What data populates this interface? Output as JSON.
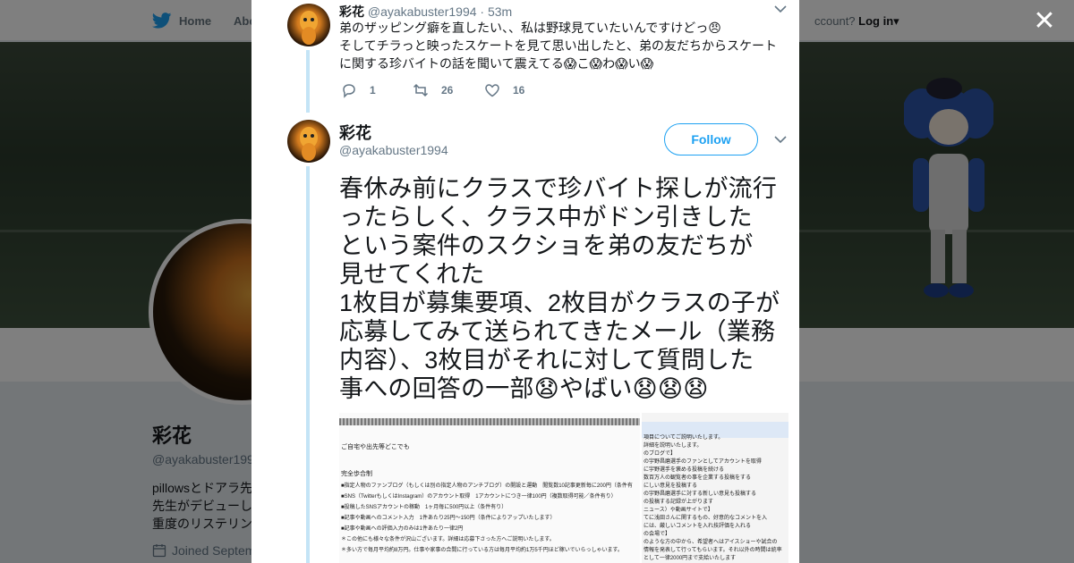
{
  "background": {
    "nav": {
      "home": "Home",
      "about": "Abo",
      "account_prompt": "ccount?",
      "login": "Log in"
    },
    "profile": {
      "name": "彩花",
      "handle": "@ayakabuster199",
      "bio_lines": [
        "pillowsとドアラ先",
        "先生がデビューし",
        "重度のリステリン"
      ],
      "joined": "Joined Septem"
    }
  },
  "modal": {
    "close_label": "✕",
    "tweet1": {
      "name": "彩花",
      "handle": "@ayakabuster1994",
      "time": "· 53m",
      "lines": [
        "弟のザッピング癖を直したい、、私は野球見ていたいんですけどっ😠",
        "そしてチラっと映ったスケートを見て思い出したと、弟の友だちからスケート",
        "に関する珍バイトの話を聞いて震えてる😱こ😱わ😱い😱"
      ],
      "replies": "1",
      "retweets": "26",
      "likes": "16"
    },
    "tweet2": {
      "name": "彩花",
      "handle": "@ayakabuster1994",
      "follow_label": "Follow",
      "text_lines": [
        "春休み前にクラスで珍バイト探しが流行",
        "ったらしく、クラス中がドン引きした",
        "という案件のスクショを弟の友だちが",
        "見せてくれた",
        "1枚目が募集要項、2枚目がクラスの子が",
        "応募してみて送られてきたメール（業務",
        "内容）、3枚目がそれに対して質問した",
        "事への回答の一部😧やばい😧😧😧"
      ]
    },
    "media": {
      "left_lines": [
        "ご自宅や出先等どこでも",
        "完全歩合制",
        "■指定人物のファンブログ（もしくは別の指定人物のアンチブログ）の開設と運動　閲覧数10記事更新毎に200円（条件有",
        "■SNS（TwitterもしくはInstagram）のアカウント取得　1アカウントにつき一律100円（複数取得可能／条件有り）",
        "■投稿したSNSアカウントの稼動　1ヶ月毎に500円以上（条件有り）",
        "■記事や動画へのコメント入力　1件あたり25円〜150円（条件によりアップいたします）",
        "■記事や動画への評価入力のみは1件あたり一律2円",
        "＊この他にも様々な条件が沢山ございます。詳細は応募下さった方へご説明いたします。",
        "＊多い方で毎月平均約8万円。仕事や家事の合間に行っている方は毎月平均約1万5千円ほど稼いでいらっしゃいます。"
      ],
      "right_lines": [
        "項目についてご説明いたします。",
        "詳細を説明いたします。",
        "のブログで】",
        "の宇野昌磨選手のファンとしてアカウントを取得",
        "に宇野選手を褒める投稿を続ける",
        "数百万人の観覧者の事を企業する投稿をする",
        "にしい意見を投稿する",
        "の宇野昌磨選手に対する新しい意見も投稿する",
        "の投稿する記録が上がります",
        "ニュース）や動画サイトで】",
        "てに浅田さんに関するもの、好意的なコメントを入",
        "には、厳しいコメントを入れ技評価を入れる",
        "の会場で】",
        "のような方の中から、希望者へはアイスショーや試合の",
        "情報を発表して行ってもらいます。それ以外の時間は統率",
        "として一律2000円まで支給いたします"
      ]
    }
  }
}
